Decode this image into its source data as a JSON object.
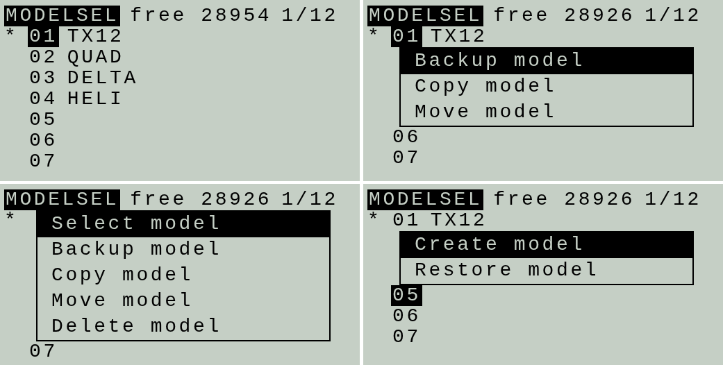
{
  "screens": [
    {
      "header": {
        "title": "MODELSEL",
        "free": "free 28954",
        "page": "1/12"
      },
      "lines": [
        {
          "kind": "row",
          "marker": "*",
          "number": "01",
          "name": "TX12",
          "selected": true
        },
        {
          "kind": "row",
          "number": "02",
          "name": "QUAD",
          "selected": false
        },
        {
          "kind": "row",
          "number": "03",
          "name": "DELTA",
          "selected": false
        },
        {
          "kind": "row",
          "number": "04",
          "name": "HELI",
          "selected": false
        },
        {
          "kind": "row",
          "number": "05",
          "selected": false
        },
        {
          "kind": "row",
          "number": "06",
          "selected": false
        },
        {
          "kind": "row",
          "number": "07",
          "selected": false
        }
      ]
    },
    {
      "header": {
        "title": "MODELSEL",
        "free": "free 28926",
        "page": "1/12"
      },
      "lines": [
        {
          "kind": "row",
          "marker": "*",
          "number": "01",
          "name": "TX12",
          "selected": true
        },
        {
          "kind": "menu",
          "items": [
            {
              "label": "Backup model",
              "selected": true
            },
            {
              "label": "Copy model",
              "selected": false
            },
            {
              "label": "Move model",
              "selected": false
            }
          ]
        },
        {
          "kind": "row",
          "number": "06",
          "selected": false
        },
        {
          "kind": "row",
          "number": "07",
          "selected": false
        }
      ]
    },
    {
      "header": {
        "title": "MODELSEL",
        "free": "free 28926",
        "page": "1/12"
      },
      "lines": [
        {
          "kind": "menu",
          "marker": "*",
          "items": [
            {
              "label": "Select model",
              "selected": true
            },
            {
              "label": "Backup model",
              "selected": false
            },
            {
              "label": "Copy model",
              "selected": false
            },
            {
              "label": "Move model",
              "selected": false
            },
            {
              "label": "Delete model",
              "selected": false
            }
          ]
        },
        {
          "kind": "row",
          "number": "07",
          "selected": false
        }
      ]
    },
    {
      "header": {
        "title": "MODELSEL",
        "free": "free 28926",
        "page": "1/12"
      },
      "lines": [
        {
          "kind": "row",
          "marker": "*",
          "number": "01",
          "name": "TX12",
          "selected": false
        },
        {
          "kind": "menu",
          "items": [
            {
              "label": "Create model",
              "selected": true
            },
            {
              "label": "Restore model",
              "selected": false
            }
          ]
        },
        {
          "kind": "row",
          "number": "05",
          "selected": true
        },
        {
          "kind": "row",
          "number": "06",
          "selected": false
        },
        {
          "kind": "row",
          "number": "07",
          "selected": false
        }
      ]
    }
  ]
}
